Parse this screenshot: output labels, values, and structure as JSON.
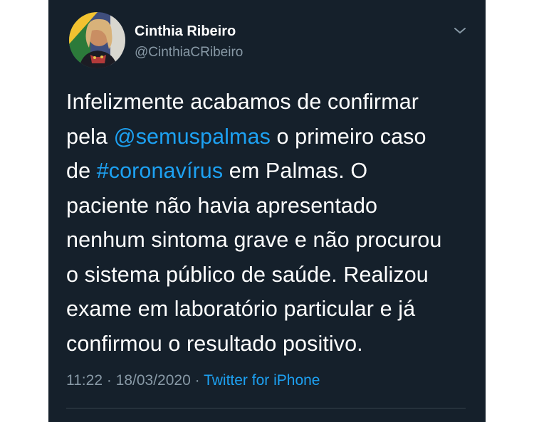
{
  "tweet": {
    "author": {
      "display_name": "Cinthia Ribeiro",
      "handle": "@CinthiaCRibeiro"
    },
    "menu_icon": "chevron-down-icon",
    "text_lines": [
      [
        {
          "t": "Infelizmente acabamos de confirmar"
        }
      ],
      [
        {
          "t": "pela "
        },
        {
          "t": "@semuspalmas",
          "link": "mention"
        },
        {
          "t": " o primeiro caso"
        }
      ],
      [
        {
          "t": "de "
        },
        {
          "t": "#coronavírus",
          "link": "hashtag"
        },
        {
          "t": " em Palmas. O"
        }
      ],
      [
        {
          "t": "paciente não havia apresentado"
        }
      ],
      [
        {
          "t": "nenhum sintoma grave e não procurou"
        }
      ],
      [
        {
          "t": "o sistema público de saúde. Realizou"
        }
      ],
      [
        {
          "t": "exame em laboratório particular e já"
        }
      ],
      [
        {
          "t": "confirmou o resultado positivo."
        }
      ]
    ],
    "time": "11:22",
    "separator": " · ",
    "date": "18/03/2020",
    "source": "Twitter for iPhone"
  },
  "colors": {
    "background": "#15202b",
    "text": "#ffffff",
    "secondary_text": "#8899a6",
    "link": "#1da1f2",
    "divider": "#38444d"
  }
}
